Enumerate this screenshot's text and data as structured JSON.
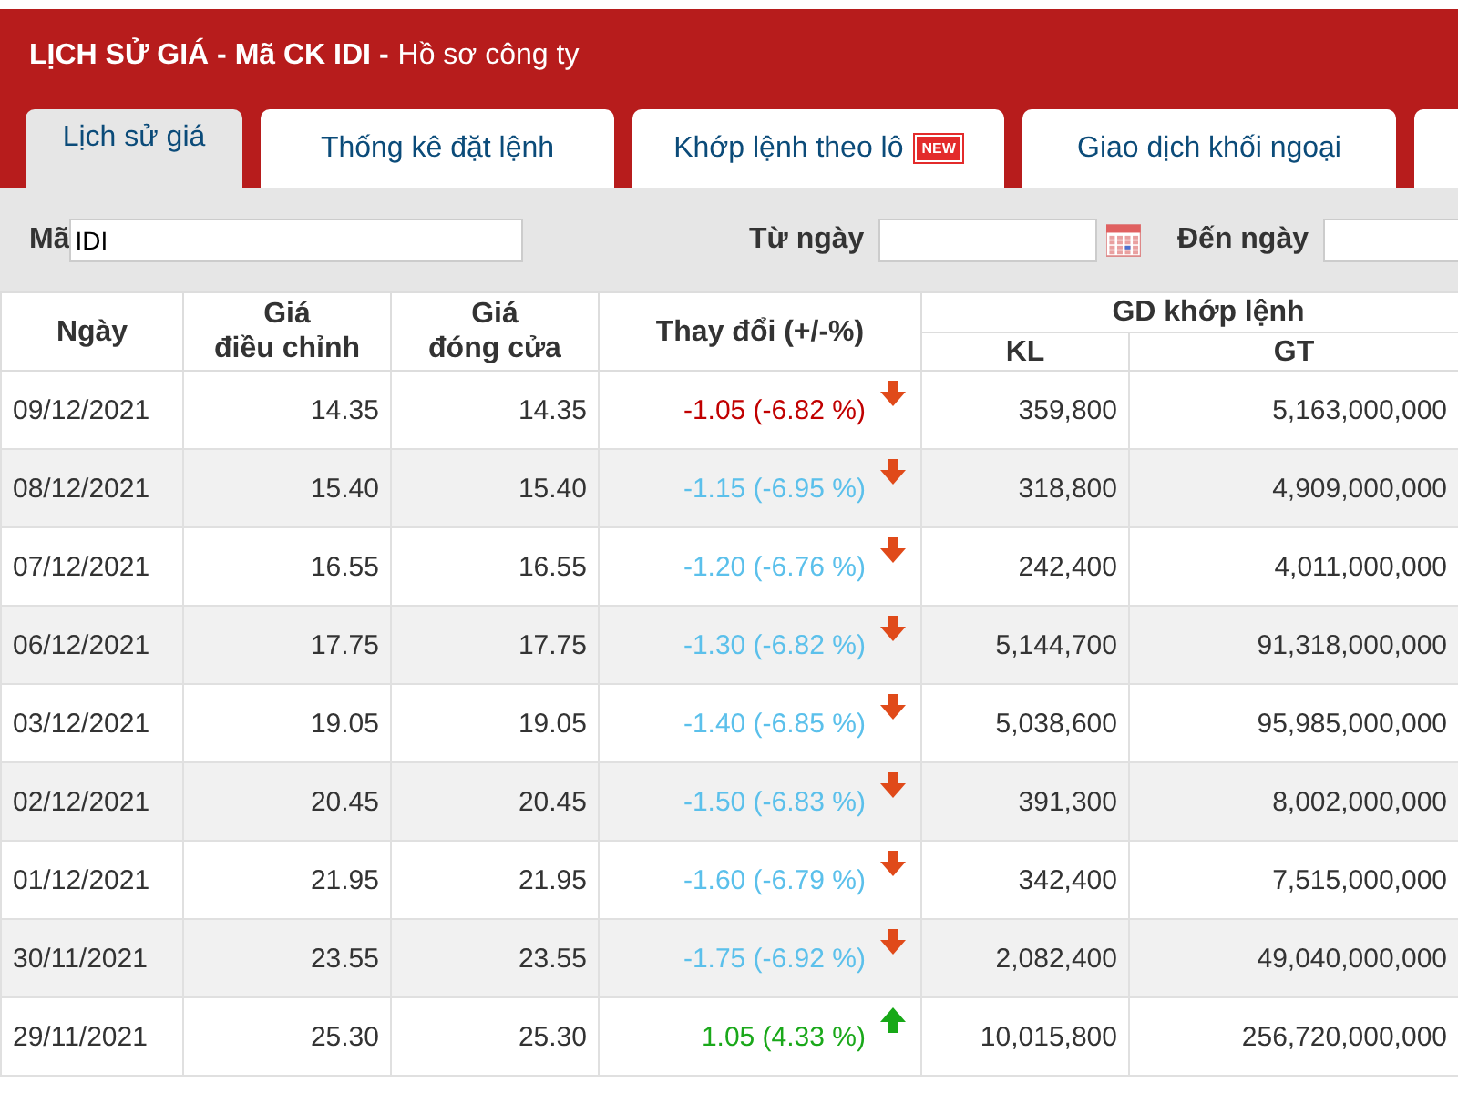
{
  "header": {
    "title_bold": "LỊCH SỬ GIÁ - Mã CK IDI -",
    "title_rest": "Hồ sơ công ty"
  },
  "tabs": [
    {
      "label": "Lịch sử giá",
      "selected": true
    },
    {
      "label": "Thống kê đặt lệnh",
      "selected": false
    },
    {
      "label": "Khớp lệnh theo lô",
      "selected": false,
      "badge": "NEW"
    },
    {
      "label": "Giao dịch khối ngoại",
      "selected": false
    },
    {
      "selected": false
    }
  ],
  "filter": {
    "code_label": "Mã",
    "code_value": "IDI",
    "from_label": "Từ ngày",
    "to_label": "Đến ngày"
  },
  "table": {
    "columns": {
      "date": "Ngày",
      "adj": "Giá\nđiều chỉnh",
      "close": "Giá\nđóng cửa",
      "change": "Thay đổi (+/-%)",
      "group": "GD khớp lệnh",
      "kl": "KL",
      "gt": "GT"
    },
    "rows": [
      {
        "date": "09/12/2021",
        "adj": "14.35",
        "close": "14.35",
        "change": "-1.05 (-6.82 %)",
        "color": "#c00000",
        "kind": "down",
        "kl": "359,800",
        "gt": "5,163,000,000"
      },
      {
        "date": "08/12/2021",
        "adj": "15.40",
        "close": "15.40",
        "change": "-1.15 (-6.95 %)",
        "color": "#5bc0eb",
        "kind": "down",
        "kl": "318,800",
        "gt": "4,909,000,000"
      },
      {
        "date": "07/12/2021",
        "adj": "16.55",
        "close": "16.55",
        "change": "-1.20 (-6.76 %)",
        "color": "#5bc0eb",
        "kind": "down",
        "kl": "242,400",
        "gt": "4,011,000,000"
      },
      {
        "date": "06/12/2021",
        "adj": "17.75",
        "close": "17.75",
        "change": "-1.30 (-6.82 %)",
        "color": "#5bc0eb",
        "kind": "down",
        "kl": "5,144,700",
        "gt": "91,318,000,000"
      },
      {
        "date": "03/12/2021",
        "adj": "19.05",
        "close": "19.05",
        "change": "-1.40 (-6.85 %)",
        "color": "#5bc0eb",
        "kind": "down",
        "kl": "5,038,600",
        "gt": "95,985,000,000"
      },
      {
        "date": "02/12/2021",
        "adj": "20.45",
        "close": "20.45",
        "change": "-1.50 (-6.83 %)",
        "color": "#5bc0eb",
        "kind": "down",
        "kl": "391,300",
        "gt": "8,002,000,000"
      },
      {
        "date": "01/12/2021",
        "adj": "21.95",
        "close": "21.95",
        "change": "-1.60 (-6.79 %)",
        "color": "#5bc0eb",
        "kind": "down",
        "kl": "342,400",
        "gt": "7,515,000,000"
      },
      {
        "date": "30/11/2021",
        "adj": "23.55",
        "close": "23.55",
        "change": "-1.75 (-6.92 %)",
        "color": "#5bc0eb",
        "kind": "down",
        "kl": "2,082,400",
        "gt": "49,040,000,000"
      },
      {
        "date": "29/11/2021",
        "adj": "25.30",
        "close": "25.30",
        "change": "1.05 (4.33 %)",
        "color": "#1aa81a",
        "kind": "up",
        "kl": "10,015,800",
        "gt": "256,720,000,000"
      }
    ]
  }
}
